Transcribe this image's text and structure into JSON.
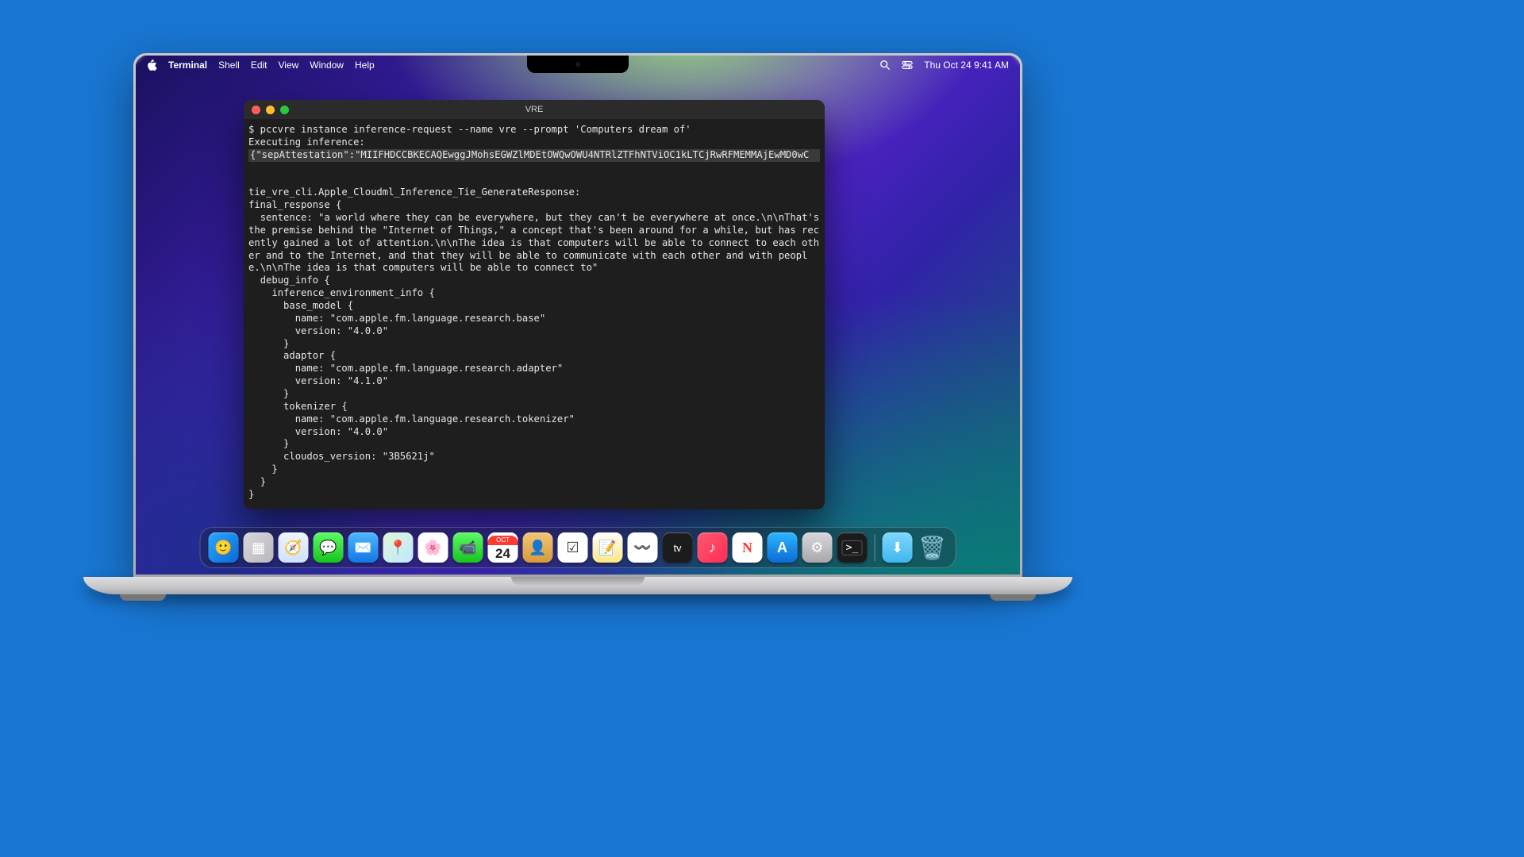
{
  "menubar": {
    "app": "Terminal",
    "items": [
      "Shell",
      "Edit",
      "View",
      "Window",
      "Help"
    ],
    "clock": "Thu Oct 24  9:41 AM"
  },
  "terminal": {
    "title": "VRE",
    "cmd": "$ pccvre instance inference-request --name vre --prompt 'Computers dream of'",
    "exec": "Executing inference:",
    "attest": "{\"sepAttestation\":\"MIIFHDCCBKECAQEwggJMohsEGWZlMDEtOWQwOWU4NTRlZTFhNTViOC1kLTCjRwRFMEMMAjEwMD0wC",
    "tie_header": "tie_vre_cli.Apple_Cloudml_Inference_Tie_GenerateResponse:",
    "body": "final_response {\n  sentence: \"a world where they can be everywhere, but they can't be everywhere at once.\\n\\nThat's the premise behind the \"Internet of Things,\" a concept that's been around for a while, but has recently gained a lot of attention.\\n\\nThe idea is that computers will be able to connect to each other and to the Internet, and that they will be able to communicate with each other and with people.\\n\\nThe idea is that computers will be able to connect to\"\n  debug_info {\n    inference_environment_info {\n      base_model {\n        name: \"com.apple.fm.language.research.base\"\n        version: \"4.0.0\"\n      }\n      adaptor {\n        name: \"com.apple.fm.language.research.adapter\"\n        version: \"4.1.0\"\n      }\n      tokenizer {\n        name: \"com.apple.fm.language.research.tokenizer\"\n        version: \"4.0.0\"\n      }\n      cloudos_version: \"3B5621j\"\n    }\n  }\n}"
  },
  "dock": {
    "calendar": {
      "month": "OCT",
      "day": "24"
    },
    "apps": [
      {
        "name": "finder",
        "bg": "linear-gradient(135deg,#2aa8ff,#0a6bd6)",
        "glyph": "🙂"
      },
      {
        "name": "launchpad",
        "bg": "linear-gradient(135deg,#d8d8dc,#b8b8bc)",
        "glyph": "▦"
      },
      {
        "name": "safari",
        "bg": "linear-gradient(180deg,#eef4ff,#cfe0ff)",
        "glyph": "🧭"
      },
      {
        "name": "messages",
        "bg": "linear-gradient(180deg,#5dfb63,#17c41d)",
        "glyph": "💬"
      },
      {
        "name": "mail",
        "bg": "linear-gradient(180deg,#4fb7ff,#1277e6)",
        "glyph": "✉️"
      },
      {
        "name": "maps",
        "bg": "linear-gradient(135deg,#dff6d6,#bfe8ff)",
        "glyph": "📍"
      },
      {
        "name": "photos",
        "bg": "#fff",
        "glyph": "🌸"
      },
      {
        "name": "facetime",
        "bg": "linear-gradient(180deg,#5dfb63,#17c41d)",
        "glyph": "📹"
      },
      {
        "name": "calendar"
      },
      {
        "name": "contacts",
        "bg": "linear-gradient(180deg,#f2c572,#d79a3a)",
        "glyph": "👤"
      },
      {
        "name": "reminders",
        "bg": "#fff",
        "glyph": "☑︎"
      },
      {
        "name": "notes",
        "bg": "linear-gradient(180deg,#fff,#ffe680)",
        "glyph": "📝"
      },
      {
        "name": "freeform",
        "bg": "#fff",
        "glyph": "〰️"
      },
      {
        "name": "tv",
        "glyph": "tv"
      },
      {
        "name": "music",
        "bg": "linear-gradient(135deg,#ff5a6e,#ff2d55)",
        "glyph": "♪"
      },
      {
        "name": "news",
        "bg": "#fff",
        "glyph": "N"
      },
      {
        "name": "appstore",
        "bg": "linear-gradient(180deg,#2bb7ff,#0a6bd6)",
        "glyph": "A"
      },
      {
        "name": "settings",
        "bg": "linear-gradient(180deg,#d8d8dc,#a8a8ac)",
        "glyph": "⚙︎"
      },
      {
        "name": "terminal"
      }
    ],
    "right": [
      {
        "name": "downloads",
        "bg": "linear-gradient(180deg,#7fd7ff,#3fb7ef)",
        "glyph": "⬇︎"
      },
      {
        "name": "trash",
        "bg": "transparent",
        "glyph": "🗑️"
      }
    ]
  }
}
